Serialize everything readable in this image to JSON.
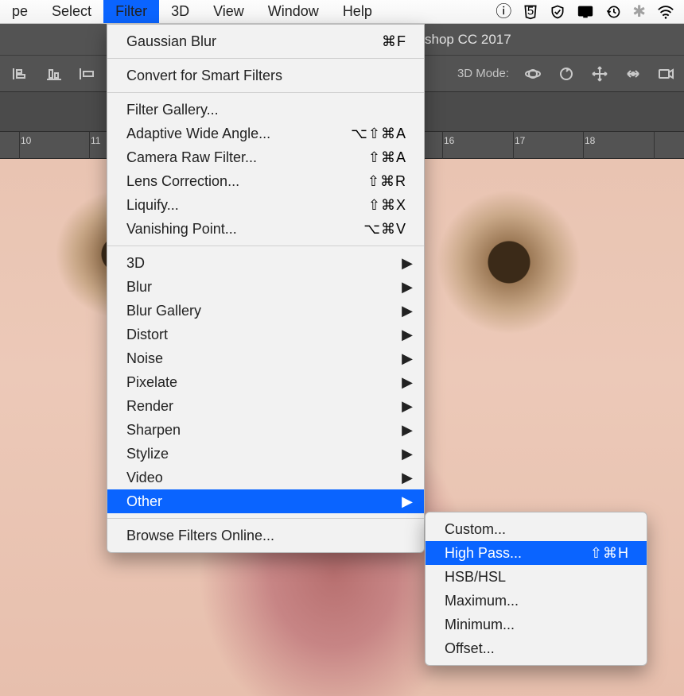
{
  "menubar": {
    "items": [
      {
        "label": "pe"
      },
      {
        "label": "Select"
      },
      {
        "label": "Filter",
        "active": true
      },
      {
        "label": "3D"
      },
      {
        "label": "View"
      },
      {
        "label": "Window"
      },
      {
        "label": "Help"
      }
    ]
  },
  "app": {
    "title": "shop CC 2017"
  },
  "optionsbar": {
    "mode_label": "3D Mode:"
  },
  "ruler": {
    "labels": [
      "10",
      "11",
      "16",
      "17",
      "18"
    ]
  },
  "filter_menu": {
    "last": {
      "label": "Gaussian Blur",
      "shortcut": "⌘F"
    },
    "convert": {
      "label": "Convert for Smart Filters"
    },
    "group_a": [
      {
        "label": "Filter Gallery...",
        "shortcut": ""
      },
      {
        "label": "Adaptive Wide Angle...",
        "shortcut": "⌥⇧⌘A"
      },
      {
        "label": "Camera Raw Filter...",
        "shortcut": "⇧⌘A"
      },
      {
        "label": "Lens Correction...",
        "shortcut": "⇧⌘R"
      },
      {
        "label": "Liquify...",
        "shortcut": "⇧⌘X"
      },
      {
        "label": "Vanishing Point...",
        "shortcut": "⌥⌘V"
      }
    ],
    "submenus": [
      {
        "label": "3D"
      },
      {
        "label": "Blur"
      },
      {
        "label": "Blur Gallery"
      },
      {
        "label": "Distort"
      },
      {
        "label": "Noise"
      },
      {
        "label": "Pixelate"
      },
      {
        "label": "Render"
      },
      {
        "label": "Sharpen"
      },
      {
        "label": "Stylize"
      },
      {
        "label": "Video"
      },
      {
        "label": "Other",
        "highlight": true
      }
    ],
    "browse": {
      "label": "Browse Filters Online..."
    }
  },
  "other_submenu": {
    "items": [
      {
        "label": "Custom...",
        "shortcut": ""
      },
      {
        "label": "High Pass...",
        "shortcut": "⇧⌘H",
        "highlight": true
      },
      {
        "label": "HSB/HSL",
        "shortcut": ""
      },
      {
        "label": "Maximum...",
        "shortcut": ""
      },
      {
        "label": "Minimum...",
        "shortcut": ""
      },
      {
        "label": "Offset...",
        "shortcut": ""
      }
    ]
  }
}
